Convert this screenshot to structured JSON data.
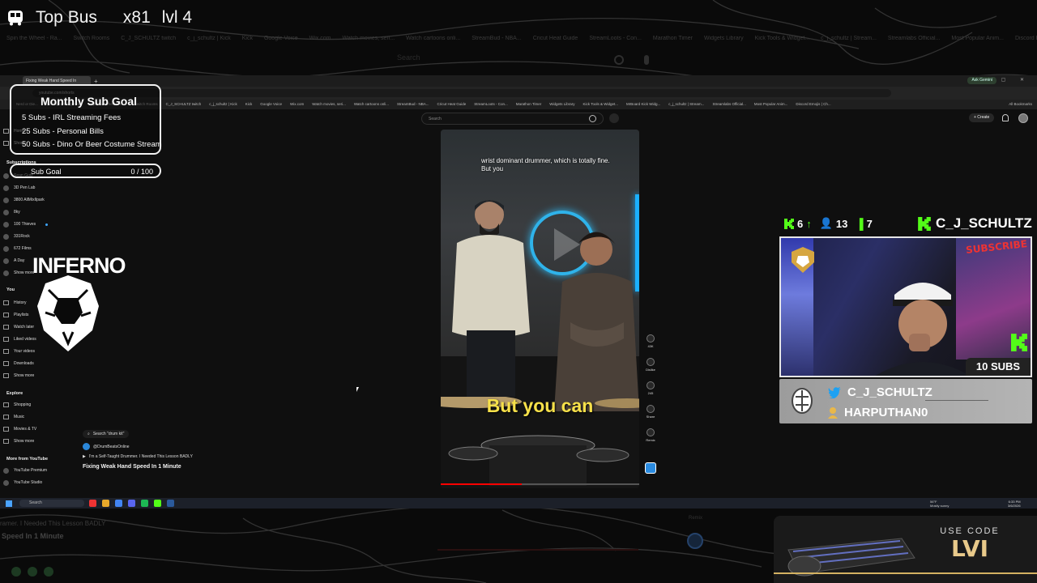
{
  "bus": {
    "title": "Top Bus",
    "multiplier": "x81",
    "level": "lvl 4"
  },
  "bg": {
    "bookmarks": [
      "Spin the Wheel - Ra...",
      "Switch Rooms",
      "C_J_SCHULTZ twitch",
      "c_j_schultz | Kick",
      "Kick",
      "Google Voice",
      "Wix.com",
      "Watch movies, seri...",
      "Watch cartoons onli...",
      "StreamBud - NBA...",
      "Cricut Heat Guide",
      "StreamLoots - Con...",
      "Marathon Timer",
      "Widgets Library",
      "Kick Tools & Widget...",
      "c_j_schultz | Stream...",
      "Streamlabs Official...",
      "Most Popular Anim...",
      "Discord Emojis | Ch..."
    ],
    "search": "Search"
  },
  "browser": {
    "tab_title": "Fixing Weak Hand Speed In",
    "url": "youtube.com/shorts",
    "gemini": "Ask Gemini",
    "bookmarks": [
      "Nerd or Die...",
      "Overlayed Widget Hi...",
      "Spin the Wheel - Ra...",
      "Switch Rooms",
      "C_J_SCHULTZ twitch",
      "c_j_schultz | Kick",
      "Kick",
      "Google Voice",
      "Wix.com",
      "Watch movies, seri...",
      "Watch cartoons onli...",
      "StreamBud - NBA...",
      "Cricut Heat Guide",
      "StreamLoots - Con...",
      "Marathon Timer",
      "Widgets Library",
      "Kick Tools & Widget...",
      "MrBoard Kick Widg...",
      "c_j_schultz | Stream...",
      "Streamlabs Official...",
      "Most Popular Anim...",
      "Discord Emojis | Ch..."
    ],
    "all_bookmarks": "All Bookmarks"
  },
  "yt": {
    "search_placeholder": "Search",
    "create": "+ Create",
    "sidebar": {
      "top": [
        "Home",
        "Shorts"
      ],
      "subs_head": "Subscriptions",
      "subs": [
        "Sean Gutz",
        "3D Pen Lab",
        "3800 AllMixIlpark",
        "8ky",
        "100 Thieves",
        "331Rock",
        "672 Films",
        "A Day",
        "Show more"
      ],
      "you_head": "You",
      "you": [
        "History",
        "Playlists",
        "Watch later",
        "Liked videos",
        "Your videos",
        "Downloads",
        "Show more"
      ],
      "explore_head": "Explore",
      "explore": [
        "Shopping",
        "Music",
        "Movies & TV",
        "Show more"
      ],
      "more_head": "More from YouTube",
      "more": [
        "YouTube Premium",
        "YouTube Studio"
      ]
    },
    "video": {
      "caption_top": "wrist dominant drummer, which is totally fine. But you",
      "caption_big": "But you can",
      "progress": 0.41
    },
    "actions": [
      {
        "label": "43K",
        "icon": "like-icon"
      },
      {
        "label": "Dislike",
        "icon": "dislike-icon"
      },
      {
        "label": "245",
        "icon": "comment-icon"
      },
      {
        "label": "Share",
        "icon": "share-icon"
      },
      {
        "label": "Remix",
        "icon": "remix-icon"
      }
    ],
    "below": {
      "chip": "Search \"drum kit\"",
      "channel": "@DrumBeatsOnline",
      "subtitle": "I'm a Self-Taught Drummer. I Needed This Lesson BADLY",
      "title": "Fixing Weak Hand Speed In 1 Minute"
    }
  },
  "taskbar": {
    "search": "Search",
    "weather_temp": "56°F",
    "weather_desc": "Mostly sunny",
    "time": "6:33 PM",
    "date": "3/6/2026"
  },
  "subgoal": {
    "title": "Monthly Sub Goal",
    "lines": [
      "5 Subs - IRL Streaming Fees",
      "25 Subs - Personal Bills",
      "50 Subs - Dino Or Beer Costume Stream"
    ],
    "bar_label": "Sub Goal",
    "bar_count": "0 / 100"
  },
  "inferno": {
    "text": "INFERNO"
  },
  "stats": {
    "followers": "6",
    "viewers": "13",
    "leaderboard": "7",
    "streamer": "C_J_SCHULTZ"
  },
  "cam": {
    "subs": "10 SUBS",
    "subscribe": "SUBSCRIBE"
  },
  "social": {
    "twitter": "C_J_SCHULTZ",
    "user": "HARPUTHAN0"
  },
  "promo": {
    "use_code": "USE CODE",
    "code": "LVI"
  },
  "ghost": {
    "line1": "ramer. I Needed This Lesson BADLY",
    "line2": "Speed In 1 Minute",
    "remix": "Remix"
  },
  "colors": {
    "kick_green": "#53fc18",
    "twitter_blue": "#1da1f2",
    "accent_gold": "#d4b262",
    "yt_red": "#ff0000"
  }
}
